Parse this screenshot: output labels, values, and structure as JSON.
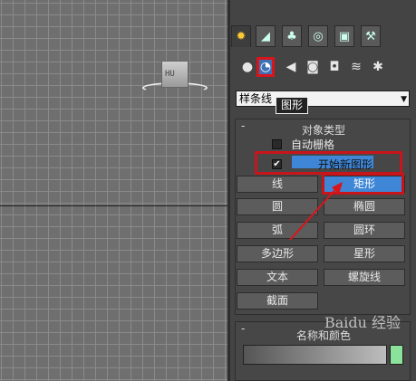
{
  "viewport": {
    "object_label": "HU"
  },
  "command_panel": {
    "tabs": [
      {
        "icon": "create-icon",
        "glyph": "✹"
      },
      {
        "icon": "modify-icon",
        "glyph": "◢"
      },
      {
        "icon": "hierarchy-icon",
        "glyph": "♣"
      },
      {
        "icon": "motion-icon",
        "glyph": "◎"
      },
      {
        "icon": "display-icon",
        "glyph": "▣"
      },
      {
        "icon": "utilities-icon",
        "glyph": "⚒"
      }
    ],
    "subcategories": [
      {
        "icon": "geometry-icon",
        "glyph": "●"
      },
      {
        "icon": "shapes-icon",
        "glyph": "◔"
      },
      {
        "icon": "lights-icon",
        "glyph": "◀"
      },
      {
        "icon": "cameras-icon",
        "glyph": "◙"
      },
      {
        "icon": "helpers-icon",
        "glyph": "◘"
      },
      {
        "icon": "spacewarps-icon",
        "glyph": "≋"
      },
      {
        "icon": "systems-icon",
        "glyph": "✱"
      }
    ],
    "dropdown": {
      "value": "样条线"
    },
    "tooltip": "图形",
    "object_type": {
      "minus": "-",
      "title": "对象类型",
      "autogrid_label": "自动栅格",
      "start_new_shape_label": "开始新图形",
      "start_new_shape_check": "✔",
      "buttons": [
        "线",
        "矩形",
        "圆",
        "椭圆",
        "弧",
        "圆环",
        "多边形",
        "星形",
        "文本",
        "螺旋线",
        "截面"
      ],
      "active_button": "矩形"
    },
    "name_color": {
      "minus": "-",
      "title": "名称和颜色"
    },
    "watermark": "Baidu 经验",
    "colors": {
      "highlight_red": "#c8151b",
      "active_blue": "#3f86d6",
      "color_swatch": "#8be29a"
    }
  }
}
